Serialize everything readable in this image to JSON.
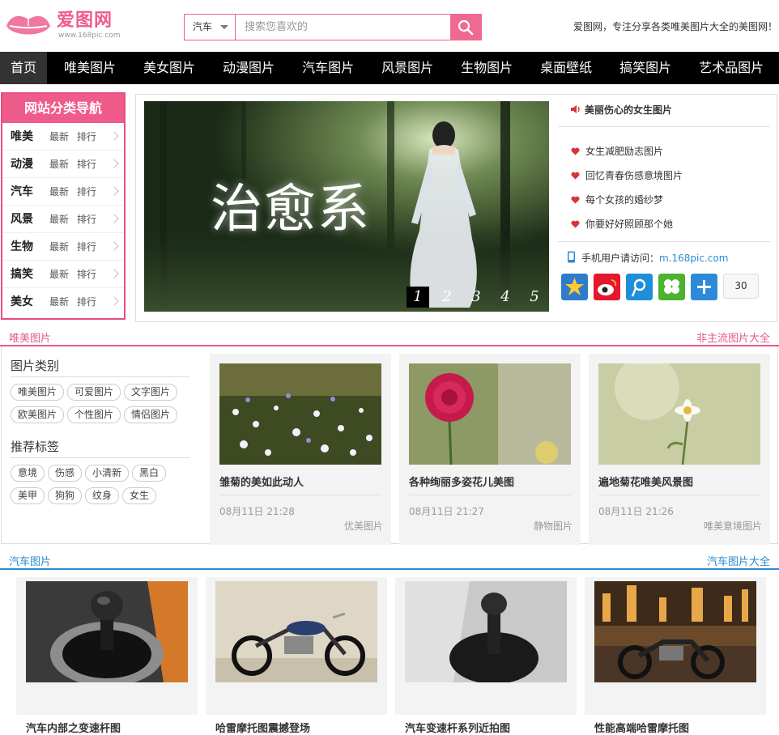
{
  "header": {
    "logo_name": "爱图网",
    "logo_url": "www.168pic.com",
    "search": {
      "category": "汽车",
      "placeholder": "搜索您喜欢的"
    },
    "slogan": "爱图网，专注分享各类唯美图片大全的美图网！"
  },
  "nav": {
    "items": [
      "首页",
      "唯美图片",
      "美女图片",
      "动漫图片",
      "汽车图片",
      "风景图片",
      "生物图片",
      "桌面壁纸",
      "搞笑图片",
      "艺术品图片"
    ]
  },
  "category_nav": {
    "title": "网站分类导航",
    "rows": [
      {
        "name": "唯美",
        "latest": "最新",
        "rank": "排行"
      },
      {
        "name": "动漫",
        "latest": "最新",
        "rank": "排行"
      },
      {
        "name": "汽车",
        "latest": "最新",
        "rank": "排行"
      },
      {
        "name": "风景",
        "latest": "最新",
        "rank": "排行"
      },
      {
        "name": "生物",
        "latest": "最新",
        "rank": "排行"
      },
      {
        "name": "搞笑",
        "latest": "最新",
        "rank": "排行"
      },
      {
        "name": "美女",
        "latest": "最新",
        "rank": "排行"
      }
    ]
  },
  "banner": {
    "title": "治愈系",
    "pages": [
      "1",
      "2",
      "3",
      "4",
      "5"
    ],
    "active_page": "1"
  },
  "sidebar": {
    "hot": "美丽伤心的女生图片",
    "links": [
      "女生减肥励志图片",
      "回忆青春伤感意境图片",
      "每个女孩的婚纱梦",
      "你要好好照顾那个她"
    ],
    "mobile_label": "手机用户请访问：",
    "mobile_link": "m.168pic.com",
    "share_icons": [
      "qzone-star-icon",
      "weibo-icon",
      "tencent-weibo-icon",
      "clover-icon",
      "plus-icon"
    ],
    "share_count": "30"
  },
  "section1": {
    "title": "唯美图片",
    "more": "非主流图片大全",
    "tag_groups": [
      {
        "title": "图片类别",
        "tags": [
          "唯美图片",
          "可爱图片",
          "文字图片",
          "欧美图片",
          "个性图片",
          "情侣图片"
        ]
      },
      {
        "title": "推荐标签",
        "tags": [
          "意境",
          "伤感",
          "小清新",
          "黑白",
          "美甲",
          "狗狗",
          "纹身",
          "女生"
        ]
      }
    ],
    "cards": [
      {
        "title": "雏菊的美如此动人",
        "date": "08月11日 21:28",
        "category": "优美图片"
      },
      {
        "title": "各种绚丽多姿花儿美图",
        "date": "08月11日 21:27",
        "category": "静物图片"
      },
      {
        "title": "遍地菊花唯美风景图",
        "date": "08月11日 21:26",
        "category": "唯美意境图片"
      }
    ]
  },
  "section2": {
    "title": "汽车图片",
    "more": "汽车图片大全",
    "cards": [
      {
        "title": "汽车内部之变速杆图"
      },
      {
        "title": "哈雷摩托图震撼登场"
      },
      {
        "title": "汽车变速杆系列近拍图"
      },
      {
        "title": "性能高端哈雷摩托图"
      }
    ]
  },
  "colors": {
    "brand_pink": "#ef5b8a",
    "nav_bg": "#000000",
    "link_blue": "#2c8bd0"
  }
}
